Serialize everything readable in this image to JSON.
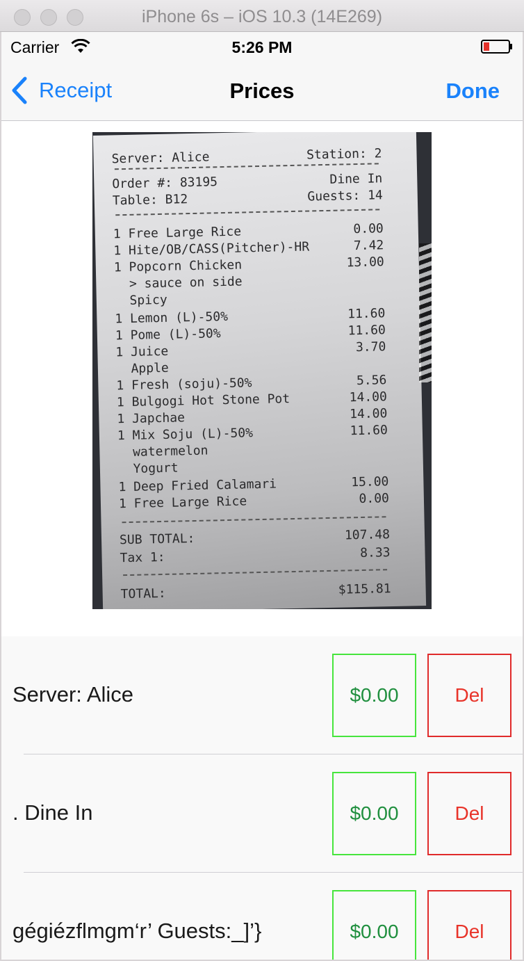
{
  "window": {
    "title": "iPhone 6s – iOS 10.3 (14E269)"
  },
  "status_bar": {
    "carrier": "Carrier",
    "time": "5:26 PM",
    "icons": [
      "wifi-icon",
      "battery-icon"
    ],
    "battery_color": "#e5322b"
  },
  "nav": {
    "back_label": "Receipt",
    "title": "Prices",
    "done_label": "Done",
    "accent": "#1a82fb"
  },
  "receipt": {
    "lines": [
      {
        "left": "Server: Alice",
        "right": "Station: 2"
      },
      {
        "left": "Order #: 83195",
        "right": "Dine In"
      },
      {
        "left": "Table: B12",
        "right": "Guests: 14"
      },
      {
        "left": "1 Free Large Rice",
        "right": "0.00"
      },
      {
        "left": "1 Hite/OB/CASS(Pitcher)-HR",
        "right": "7.42"
      },
      {
        "left": "1 Popcorn Chicken",
        "right": "13.00"
      },
      {
        "left": "  > sauce on side",
        "right": ""
      },
      {
        "left": "  Spicy",
        "right": ""
      },
      {
        "left": "1 Lemon (L)-50%",
        "right": "11.60"
      },
      {
        "left": "1 Pome (L)-50%",
        "right": "11.60"
      },
      {
        "left": "1 Juice",
        "right": "3.70"
      },
      {
        "left": "  Apple",
        "right": ""
      },
      {
        "left": "1 Fresh (soju)-50%",
        "right": "5.56"
      },
      {
        "left": "1 Bulgogi Hot Stone Pot",
        "right": "14.00"
      },
      {
        "left": "1 Japchae",
        "right": "14.00"
      },
      {
        "left": "1 Mix Soju (L)-50%",
        "right": "11.60"
      },
      {
        "left": "  watermelon",
        "right": ""
      },
      {
        "left": "  Yogurt",
        "right": ""
      },
      {
        "left": "1 Deep Fried Calamari",
        "right": "15.00"
      },
      {
        "left": "1 Free Large Rice",
        "right": "0.00"
      },
      {
        "left": "SUB TOTAL:",
        "right": "107.48"
      },
      {
        "left": "Tax 1:",
        "right": "8.33"
      },
      {
        "left": "TOTAL:",
        "right": "$115.81"
      }
    ]
  },
  "items": [
    {
      "label": "Server: Alice",
      "price": "$0.00",
      "delete": "Del"
    },
    {
      "label": ". Dine In",
      "price": "$0.00",
      "delete": "Del"
    },
    {
      "label": "gégiézflmgm‘r’ Guests:_]’}",
      "price": "$0.00",
      "delete": "Del"
    }
  ],
  "colors": {
    "price_border": "#47e53d",
    "price_text": "#1f8f3e",
    "delete_border": "#e02b2b",
    "delete_text": "#e8342a"
  }
}
